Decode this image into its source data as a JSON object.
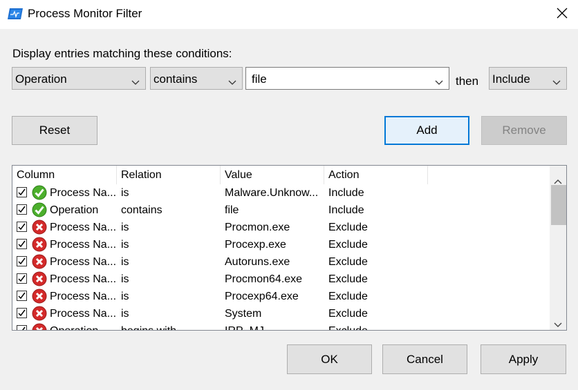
{
  "window": {
    "title": "Process Monitor Filter"
  },
  "filter_editor": {
    "caption": "Display entries matching these conditions:",
    "column": "Operation",
    "relation": "contains",
    "value": "file",
    "then_label": "then",
    "action": "Include"
  },
  "buttons": {
    "reset": "Reset",
    "add": "Add",
    "remove": "Remove",
    "ok": "OK",
    "cancel": "Cancel",
    "apply": "Apply"
  },
  "list": {
    "headers": [
      "Column",
      "Relation",
      "Value",
      "Action"
    ],
    "rows": [
      {
        "checked": true,
        "action_type": "include",
        "column": "Process Na...",
        "relation": "is",
        "value": "Malware.Unknow...",
        "action": "Include"
      },
      {
        "checked": true,
        "action_type": "include",
        "column": "Operation",
        "relation": "contains",
        "value": "file",
        "action": "Include"
      },
      {
        "checked": true,
        "action_type": "exclude",
        "column": "Process Na...",
        "relation": "is",
        "value": "Procmon.exe",
        "action": "Exclude"
      },
      {
        "checked": true,
        "action_type": "exclude",
        "column": "Process Na...",
        "relation": "is",
        "value": "Procexp.exe",
        "action": "Exclude"
      },
      {
        "checked": true,
        "action_type": "exclude",
        "column": "Process Na...",
        "relation": "is",
        "value": "Autoruns.exe",
        "action": "Exclude"
      },
      {
        "checked": true,
        "action_type": "exclude",
        "column": "Process Na...",
        "relation": "is",
        "value": "Procmon64.exe",
        "action": "Exclude"
      },
      {
        "checked": true,
        "action_type": "exclude",
        "column": "Process Na...",
        "relation": "is",
        "value": "Procexp64.exe",
        "action": "Exclude"
      },
      {
        "checked": true,
        "action_type": "exclude",
        "column": "Process Na...",
        "relation": "is",
        "value": "System",
        "action": "Exclude"
      },
      {
        "checked": true,
        "action_type": "exclude",
        "column": "Operation",
        "relation": "begins with",
        "value": "IRP_MJ_",
        "action": "Exclude"
      }
    ]
  },
  "icons": {
    "app": "process-monitor-icon",
    "close": "close-icon",
    "include": "green-check-icon",
    "exclude": "red-x-icon"
  },
  "colors": {
    "include_green": "#4caf2c",
    "exclude_red": "#d32a2a",
    "default_button_border": "#0078d7"
  }
}
